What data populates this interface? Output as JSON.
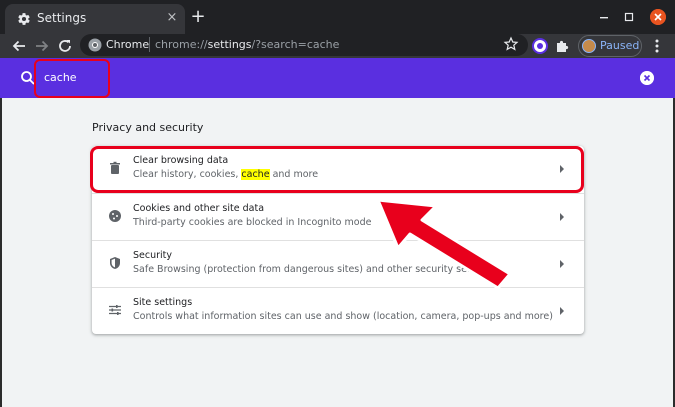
{
  "tab": {
    "title": "Settings",
    "close": "×",
    "new_tab": "+"
  },
  "omnibox": {
    "site_label": "Chrome",
    "url_host": "chrome://",
    "url_path": "settings",
    "url_rest": "/?search=cache"
  },
  "profile": {
    "label": "Paused"
  },
  "search": {
    "value": "cache"
  },
  "section": {
    "title": "Privacy and security"
  },
  "rows": [
    {
      "title": "Clear browsing data",
      "subtitle_before": "Clear history, cookies, ",
      "subtitle_match": "cache",
      "subtitle_after": " and more",
      "icon": "trash-icon"
    },
    {
      "title": "Cookies and other site data",
      "subtitle": "Third-party cookies are blocked in Incognito mode",
      "icon": "cookie-icon"
    },
    {
      "title": "Security",
      "subtitle": "Safe Browsing (protection from dangerous sites) and other security settings",
      "icon": "shield-icon"
    },
    {
      "title": "Site settings",
      "subtitle": "Controls what information sites can use and show (location, camera, pop-ups and more)",
      "icon": "sliders-icon"
    }
  ],
  "colors": {
    "header": "#5a2fe0",
    "annotation": "#e8001c",
    "highlight": "#ffff00"
  }
}
